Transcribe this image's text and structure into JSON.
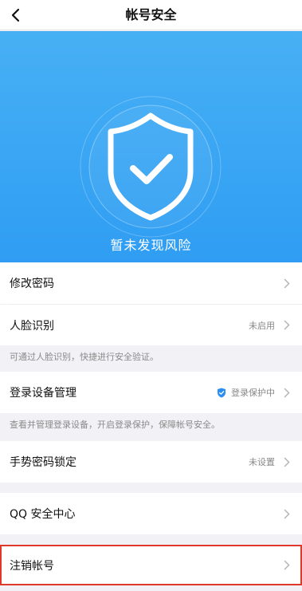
{
  "nav": {
    "title": "帐号安全"
  },
  "hero": {
    "status": "暂未发现风险"
  },
  "items": {
    "change_password": {
      "label": "修改密码"
    },
    "face_id": {
      "label": "人脸识别",
      "value": "未启用",
      "note": "可通过人脸识别，快捷进行安全验证。"
    },
    "device_mgmt": {
      "label": "登录设备管理",
      "value": "登录保护中",
      "note": "查看并管理登录设备，开启登录保护，保障帐号安全。"
    },
    "gesture_lock": {
      "label": "手势密码锁定",
      "value": "未设置"
    },
    "qq_security": {
      "label": "QQ 安全中心"
    },
    "deactivate": {
      "label": "注销帐号"
    }
  },
  "colors": {
    "hero": "#2f9df3",
    "accent": "#2a8ff0",
    "highlight_border": "#e0382b"
  }
}
